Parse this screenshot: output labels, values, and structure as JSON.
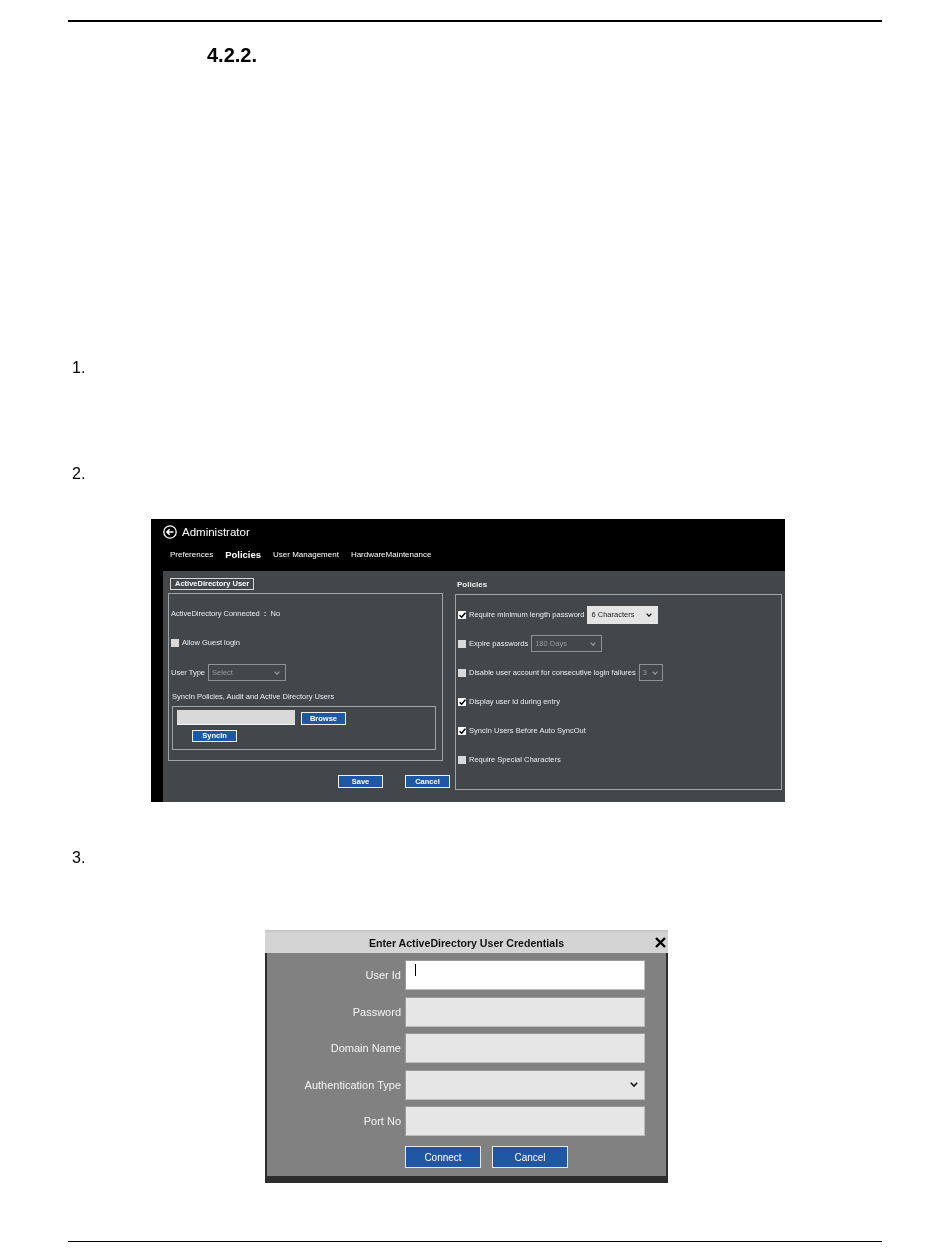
{
  "document": {
    "section_number": "4.2.2.",
    "steps": [
      {
        "number": "1."
      },
      {
        "number": "2."
      },
      {
        "number": "3."
      }
    ]
  },
  "admin_screen": {
    "title": "Administrator",
    "tabs": [
      {
        "label": "Preferences",
        "selected": false
      },
      {
        "label": "Policies",
        "selected": true
      },
      {
        "label": "User Management",
        "selected": false
      },
      {
        "label": "HardwareMaintenance",
        "selected": false
      }
    ],
    "active_directory": {
      "group_label": "ActiveDirectory User",
      "connected_label": "ActiveDirectory Connected",
      "connected_separator": ":",
      "connected_value": "No",
      "guest_login": {
        "label": "Allow Guest login",
        "checked": false
      },
      "user_type": {
        "label": "User Type",
        "placeholder": "Select",
        "disabled": true
      },
      "sync_title": "SyncIn Policies, Audit and Active Directory Users",
      "sync_buttons": [
        {
          "label": "Browse"
        },
        {
          "label": "SyncIn"
        }
      ]
    },
    "buttons": [
      {
        "label": "Save"
      },
      {
        "label": "Cancel"
      }
    ],
    "policies": {
      "title": "Policies",
      "items": [
        {
          "label": "Require minimum length password",
          "checked": true,
          "dropdown": {
            "value": "6 Characters",
            "disabled": false
          }
        },
        {
          "label": "Expire passwords",
          "checked": false,
          "dropdown": {
            "value": "180 Days",
            "disabled": true
          }
        },
        {
          "label": "Disable user account for consecutive login failures",
          "checked": false,
          "dropdown": {
            "value": "3",
            "disabled": true
          }
        },
        {
          "label": "Display user id during entry",
          "checked": true
        },
        {
          "label": "SyncIn Users Before Auto SyncOut",
          "checked": true
        },
        {
          "label": "Require Special Characters",
          "checked": false
        }
      ]
    }
  },
  "credentials_dialog": {
    "title": "Enter ActiveDirectory User Credentials",
    "fields": [
      {
        "label": "User Id",
        "kind": "text",
        "focused": true
      },
      {
        "label": "Password",
        "kind": "text",
        "focused": false
      },
      {
        "label": "Domain Name",
        "kind": "text",
        "focused": false
      },
      {
        "label": "Authentication Type",
        "kind": "dropdown",
        "focused": false
      },
      {
        "label": "Port No",
        "kind": "text",
        "focused": false
      }
    ],
    "buttons": [
      {
        "label": "Connect"
      },
      {
        "label": "Cancel"
      }
    ]
  }
}
